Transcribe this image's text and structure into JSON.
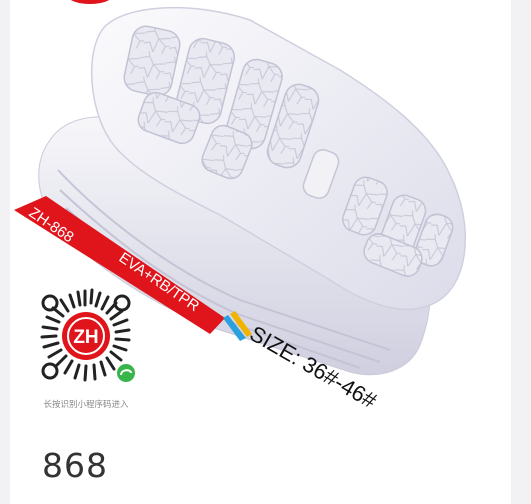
{
  "product": {
    "model_code": "ZH-868",
    "materials": "EVA+RB/TPR",
    "size_range": "SIZE: 36#-46#",
    "caption": "868"
  },
  "qr": {
    "hint": "长按识别小程序码进入",
    "logo_letters": "ZH"
  },
  "colors": {
    "banner_red": "#e0141b",
    "sole_white": "#f4f4f8",
    "sole_shadow": "#d9d9e6",
    "mini_program_green": "#38b54a"
  }
}
